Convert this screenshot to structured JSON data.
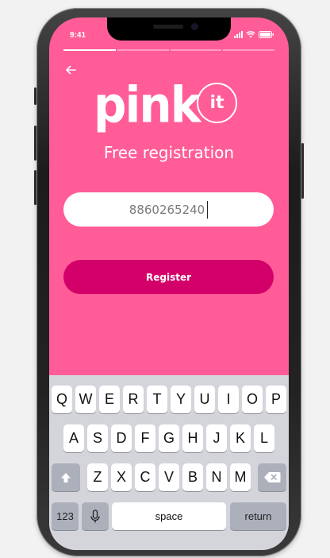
{
  "status_bar": {
    "time": "9:41",
    "icons": [
      "signal-icon",
      "wifi-icon",
      "battery-icon"
    ]
  },
  "progress": {
    "fraction": 0.25,
    "segments": 4
  },
  "nav": {
    "back_icon": "arrow-left-icon"
  },
  "logo": {
    "text": "pink",
    "badge": "it"
  },
  "title": "Free registration",
  "phone_input": {
    "value": "8860265240"
  },
  "register_button": {
    "label": "Register"
  },
  "colors": {
    "background": "#ff5c98",
    "button": "#d4006a",
    "text": "#ffffff"
  },
  "keyboard": {
    "row1": [
      "Q",
      "W",
      "E",
      "R",
      "T",
      "Y",
      "U",
      "I",
      "O",
      "P"
    ],
    "row2": [
      "A",
      "S",
      "D",
      "F",
      "G",
      "H",
      "J",
      "K",
      "L"
    ],
    "row3": [
      "Z",
      "X",
      "C",
      "V",
      "B",
      "N",
      "M"
    ],
    "shift_icon": "shift-icon",
    "backspace_icon": "backspace-icon",
    "numbers_label": "123",
    "mic_icon": "microphone-icon",
    "space_label": "space",
    "return_label": "return"
  }
}
